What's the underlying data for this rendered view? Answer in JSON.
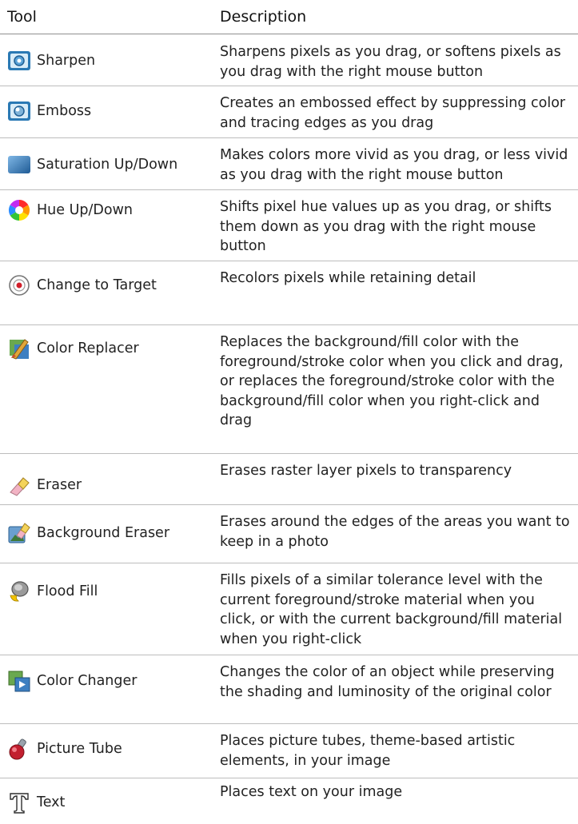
{
  "header": {
    "tool": "Tool",
    "description": "Description"
  },
  "rows": [
    {
      "name": "Sharpen",
      "icon": "sharpen-icon",
      "description": "Sharpens pixels as you drag, or softens pixels as you drag with the right mouse button"
    },
    {
      "name": "Emboss",
      "icon": "emboss-icon",
      "description": "Creates an embossed effect by suppressing color and tracing edges as you drag"
    },
    {
      "name": "Saturation Up/Down",
      "icon": "saturation-icon",
      "description": "Makes colors more vivid as you drag, or less vivid as you drag with the right mouse button"
    },
    {
      "name": "Hue Up/Down",
      "icon": "hue-wheel-icon",
      "description": "Shifts pixel hue values up as you drag, or shifts them down as you drag with the right mouse button"
    },
    {
      "name": "Change to Target",
      "icon": "target-icon",
      "description": "Recolors pixels while retaining detail"
    },
    {
      "name": "Color Replacer",
      "icon": "color-replacer-icon",
      "description": "Replaces the background/fill color with the foreground/stroke color when you click and drag, or replaces the foreground/stroke color with the background/fill color when you right-click and drag"
    },
    {
      "name": "Eraser",
      "icon": "eraser-icon",
      "description": "Erases raster layer pixels to transparency"
    },
    {
      "name": "Background Eraser",
      "icon": "background-eraser-icon",
      "description": "Erases around the edges of the areas you want to keep in a photo"
    },
    {
      "name": "Flood Fill",
      "icon": "flood-fill-icon",
      "description": "Fills pixels of a similar tolerance level with the current foreground/stroke material when you click, or with the current background/fill material when you right-click"
    },
    {
      "name": "Color Changer",
      "icon": "color-changer-icon",
      "description": "Changes the color of an object while preserving the shading and luminosity of the original color"
    },
    {
      "name": "Picture Tube",
      "icon": "picture-tube-icon",
      "description": "Places picture tubes, theme-based artistic elements, in your image"
    },
    {
      "name": "Text",
      "icon": "text-icon",
      "description": "Places text on your image"
    }
  ]
}
